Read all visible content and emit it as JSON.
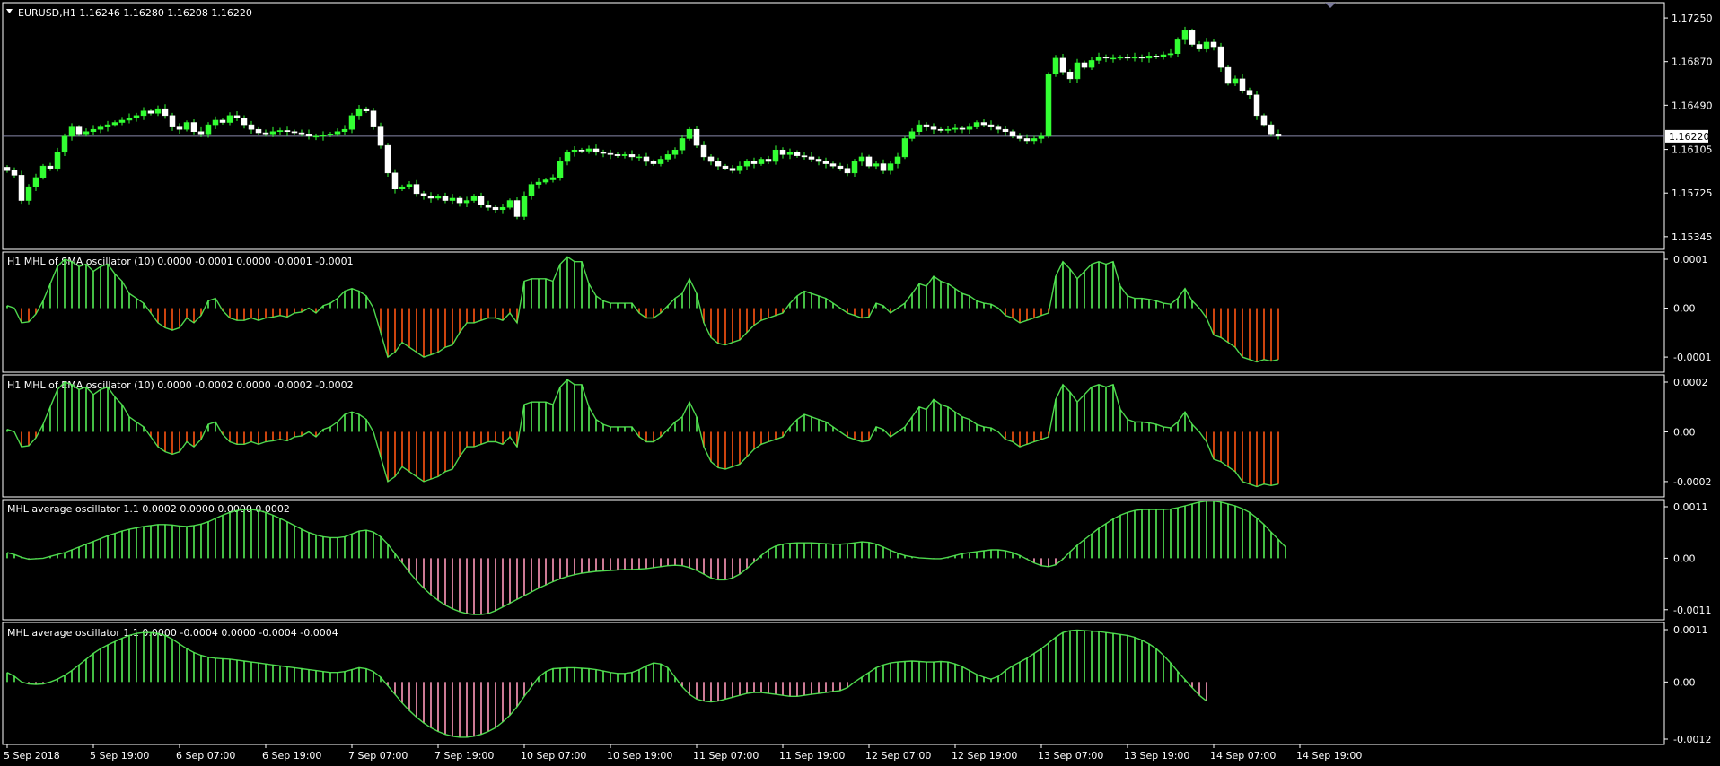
{
  "colors": {
    "background": "#000000",
    "frame": "#ffffff",
    "bull": "#33ff33",
    "bear": "#ffffff",
    "wick": "#33ff33",
    "osc_pos": "#55ee55",
    "osc_neg": "#ff5511",
    "avg_neg": "#ff99bb",
    "price_line": "#8888aa",
    "price_badge_bg": "#ffffff",
    "price_badge_text": "#000000"
  },
  "main": {
    "symbol_label": "EURUSD,H1  1.16246 1.16280 1.16208 1.16220",
    "current_price": "1.16220",
    "y_ticks": [
      "1.17250",
      "1.16870",
      "1.16490",
      "1.16105",
      "1.15725",
      "1.15345"
    ],
    "y_range": [
      1.1525,
      1.1736
    ],
    "current_value": 1.1622
  },
  "panels": [
    {
      "label": "H1 MHL of SMA oscillator (10) 0.0000 -0.0001 0.0000 -0.0001 -0.0001",
      "ticks": [
        "0.0001",
        "0.00",
        "-0.0001"
      ],
      "tick_values": [
        0.0001,
        0,
        -0.0001
      ],
      "neg_color_key": "osc_neg"
    },
    {
      "label": "H1 MHL of EMA oscillator (10) 0.0000 -0.0002 0.0000 -0.0002 -0.0002",
      "ticks": [
        "0.0002",
        "0.00",
        "-0.0002"
      ],
      "tick_values": [
        0.0002,
        0,
        -0.0002
      ],
      "neg_color_key": "osc_neg"
    },
    {
      "label": "MHL average oscillator 1.1 0.0002 0.0000 0.0000 0.0002",
      "ticks": [
        "0.0011",
        "0.00",
        "-0.0011"
      ],
      "tick_values": [
        0.0011,
        0,
        -0.0011
      ],
      "neg_color_key": "avg_neg"
    },
    {
      "label": "MHL average oscillator 1.1 0.0000 -0.0004 0.0000 -0.0004 -0.0004",
      "ticks": [
        "0.0011",
        "0.00",
        "-0.0012"
      ],
      "tick_values": [
        0.0011,
        0,
        -0.0012
      ],
      "neg_color_key": "avg_neg"
    }
  ],
  "x_axis": {
    "labels": [
      "5 Sep 2018",
      "5 Sep 19:00",
      "6 Sep 07:00",
      "6 Sep 19:00",
      "7 Sep 07:00",
      "7 Sep 19:00",
      "10 Sep 07:00",
      "10 Sep 19:00",
      "11 Sep 07:00",
      "11 Sep 19:00",
      "12 Sep 07:00",
      "12 Sep 19:00",
      "13 Sep 07:00",
      "13 Sep 19:00",
      "14 Sep 07:00",
      "14 Sep 19:00"
    ],
    "label_bar_index": [
      0,
      12,
      24,
      36,
      48,
      60,
      72,
      84,
      96,
      108,
      120,
      132,
      144,
      156,
      168,
      180
    ]
  },
  "chart_data": [
    {
      "type": "candlestick",
      "title": "EURUSD,H1",
      "closes": [
        1.1592,
        1.1588,
        1.1566,
        1.1578,
        1.1586,
        1.1596,
        1.1594,
        1.1608,
        1.1622,
        1.163,
        1.1624,
        1.1626,
        1.1628,
        1.163,
        1.1632,
        1.1634,
        1.1636,
        1.1638,
        1.164,
        1.1644,
        1.1642,
        1.1646,
        1.164,
        1.163,
        1.1628,
        1.1634,
        1.1626,
        1.1624,
        1.1632,
        1.1636,
        1.1634,
        1.164,
        1.1638,
        1.1632,
        1.1628,
        1.1625,
        1.1624,
        1.1626,
        1.1627,
        1.1626,
        1.1625,
        1.1624,
        1.1622,
        1.1622,
        1.1623,
        1.1624,
        1.1626,
        1.1628,
        1.164,
        1.1646,
        1.1644,
        1.163,
        1.1614,
        1.159,
        1.1576,
        1.1578,
        1.158,
        1.1572,
        1.157,
        1.1568,
        1.157,
        1.1566,
        1.1568,
        1.1564,
        1.1566,
        1.157,
        1.1562,
        1.156,
        1.1558,
        1.156,
        1.1566,
        1.1552,
        1.157,
        1.158,
        1.1582,
        1.1584,
        1.1586,
        1.16,
        1.1608,
        1.161,
        1.1609,
        1.1611,
        1.1608,
        1.1607,
        1.1606,
        1.1605,
        1.1606,
        1.1604,
        1.1604,
        1.16,
        1.1598,
        1.1602,
        1.1606,
        1.161,
        1.162,
        1.1628,
        1.1614,
        1.1604,
        1.16,
        1.1596,
        1.1594,
        1.1592,
        1.1596,
        1.16,
        1.1598,
        1.1602,
        1.16,
        1.161,
        1.1606,
        1.1608,
        1.1605,
        1.1604,
        1.1602,
        1.16,
        1.1598,
        1.1596,
        1.1594,
        1.159,
        1.16,
        1.1604,
        1.1596,
        1.1598,
        1.1592,
        1.1598,
        1.1604,
        1.162,
        1.1626,
        1.1632,
        1.163,
        1.1628,
        1.1627,
        1.1628,
        1.1629,
        1.1628,
        1.163,
        1.1634,
        1.1632,
        1.163,
        1.1628,
        1.1626,
        1.1622,
        1.162,
        1.1618,
        1.162,
        1.1622,
        1.1676,
        1.169,
        1.1678,
        1.1672,
        1.1686,
        1.1682,
        1.1688,
        1.1691,
        1.169,
        1.169,
        1.1691,
        1.169,
        1.1691,
        1.169,
        1.1692,
        1.1691,
        1.1693,
        1.1694,
        1.1706,
        1.1714,
        1.1702,
        1.1698,
        1.1704,
        1.17,
        1.1682,
        1.1668,
        1.1672,
        1.1662,
        1.1658,
        1.164,
        1.1632,
        1.1624,
        1.1622
      ]
    },
    {
      "type": "histogram",
      "title": "H1 MHL of SMA oscillator (10)",
      "ylim": [
        -0.00012,
        0.0001
      ],
      "values": [
        5e-06,
        0,
        -3e-05,
        -2.8e-05,
        -1.2e-05,
        1.5e-05,
        5e-05,
        8.5e-05,
        0.0001,
        9.5e-05,
        8.5e-05,
        9e-05,
        7.5e-05,
        8.5e-05,
        9e-05,
        7e-05,
        5.5e-05,
        3e-05,
        2e-05,
        1e-05,
        -1e-05,
        -3e-05,
        -4e-05,
        -4.5e-05,
        -4e-05,
        -2e-05,
        -3e-05,
        -1.5e-05,
        1.5e-05,
        2e-05,
        -5e-06,
        -2e-05,
        -2.5e-05,
        -2.5e-05,
        -2e-05,
        -2.5e-05,
        -2e-05,
        -1.8e-05,
        -1.5e-05,
        -1.8e-05,
        -1e-05,
        -8e-06,
        0,
        -1e-05,
        5e-06,
        1e-05,
        2e-05,
        3.5e-05,
        4e-05,
        3.5e-05,
        2.5e-05,
        0,
        -5e-05,
        -0.0001,
        -9e-05,
        -7e-05,
        -8e-05,
        -9e-05,
        -0.0001,
        -9.5e-05,
        -9e-05,
        -8e-05,
        -7.5e-05,
        -5e-05,
        -3e-05,
        -3e-05,
        -2.5e-05,
        -2e-05,
        -2e-05,
        -2.5e-05,
        -1e-05,
        -3e-05,
        5.5e-05,
        6e-05,
        6e-05,
        6e-05,
        5.5e-05,
        9e-05,
        0.000105,
        9.5e-05,
        9.5e-05,
        5e-05,
        2.5e-05,
        1.5e-05,
        1e-05,
        1e-05,
        1e-05,
        1e-05,
        -1e-05,
        -2e-05,
        -2e-05,
        -1e-05,
        5e-06,
        2e-05,
        3e-05,
        6e-05,
        3e-05,
        -3e-05,
        -6e-05,
        -7.2e-05,
        -7.5e-05,
        -7e-05,
        -6.5e-05,
        -5e-05,
        -3.5e-05,
        -2.5e-05,
        -2e-05,
        -1.5e-05,
        -1e-05,
        1e-05,
        2.5e-05,
        3.5e-05,
        3e-05,
        2.5e-05,
        2e-05,
        1e-05,
        0,
        -1e-05,
        -1.5e-05,
        -2e-05,
        -1.8e-05,
        1e-05,
        5e-06,
        -1e-05,
        0,
        1e-05,
        3e-05,
        5e-05,
        4.5e-05,
        6.5e-05,
        5.5e-05,
        5e-05,
        4e-05,
        3e-05,
        2.5e-05,
        1.5e-05,
        1e-05,
        8e-06,
        0,
        -1.5e-05,
        -2e-05,
        -3e-05,
        -2.5e-05,
        -2e-05,
        -1.5e-05,
        -1e-05,
        6.5e-05,
        9.5e-05,
        8e-05,
        6e-05,
        7.5e-05,
        9e-05,
        9.5e-05,
        9e-05,
        9.5e-05,
        4.5e-05,
        2.5e-05,
        2e-05,
        2e-05,
        1.8e-05,
        1.5e-05,
        1e-05,
        8e-06,
        2e-05,
        4e-05,
        1.5e-05,
        0,
        -2e-05,
        -5.5e-05,
        -6e-05,
        -7e-05,
        -8e-05,
        -0.0001,
        -0.000105,
        -0.00011,
        -0.000105,
        -0.000108,
        -0.000105
      ]
    },
    {
      "type": "histogram",
      "title": "H1 MHL of EMA oscillator (10)",
      "ylim": [
        -0.00024,
        0.0002
      ],
      "values": [
        1e-05,
        0,
        -6e-05,
        -5.6e-05,
        -2.4e-05,
        3e-05,
        0.0001,
        0.00017,
        0.0002,
        0.00019,
        0.00017,
        0.00018,
        0.00015,
        0.00017,
        0.00018,
        0.00014,
        0.00011,
        6e-05,
        4e-05,
        2e-05,
        -2e-05,
        -6e-05,
        -8e-05,
        -9e-05,
        -8e-05,
        -4e-05,
        -6e-05,
        -3e-05,
        3e-05,
        4e-05,
        -1e-05,
        -4e-05,
        -5e-05,
        -5e-05,
        -4e-05,
        -5e-05,
        -4e-05,
        -3.6e-05,
        -3e-05,
        -3.6e-05,
        -2e-05,
        -1.6e-05,
        0,
        -2e-05,
        1e-05,
        2e-05,
        4e-05,
        7e-05,
        8e-05,
        7e-05,
        5e-05,
        0,
        -0.0001,
        -0.0002,
        -0.00018,
        -0.00014,
        -0.00016,
        -0.00018,
        -0.0002,
        -0.00019,
        -0.00018,
        -0.00016,
        -0.00015,
        -0.0001,
        -6e-05,
        -6e-05,
        -5e-05,
        -4e-05,
        -4e-05,
        -5e-05,
        -2e-05,
        -6e-05,
        0.00011,
        0.00012,
        0.00012,
        0.00012,
        0.00011,
        0.00018,
        0.00021,
        0.00019,
        0.00019,
        0.0001,
        5e-05,
        3e-05,
        2e-05,
        2e-05,
        2e-05,
        2e-05,
        -2e-05,
        -4e-05,
        -4e-05,
        -2e-05,
        1e-05,
        4e-05,
        6e-05,
        0.00012,
        6e-05,
        -6e-05,
        -0.00012,
        -0.000144,
        -0.00015,
        -0.00014,
        -0.00013,
        -0.0001,
        -7e-05,
        -5e-05,
        -4e-05,
        -3e-05,
        -2e-05,
        2e-05,
        5e-05,
        7e-05,
        6e-05,
        5e-05,
        4e-05,
        2e-05,
        0,
        -2e-05,
        -3e-05,
        -4e-05,
        -3.6e-05,
        2e-05,
        1e-05,
        -2e-05,
        0,
        2e-05,
        6e-05,
        0.0001,
        9e-05,
        0.00013,
        0.00011,
        0.0001,
        8e-05,
        6e-05,
        5e-05,
        3e-05,
        2e-05,
        1.6e-05,
        0,
        -3e-05,
        -4e-05,
        -6e-05,
        -5e-05,
        -4e-05,
        -3e-05,
        -2e-05,
        0.00013,
        0.00019,
        0.00016,
        0.00012,
        0.00015,
        0.00018,
        0.00019,
        0.00018,
        0.00019,
        9e-05,
        5e-05,
        4e-05,
        4e-05,
        3.6e-05,
        3e-05,
        2e-05,
        1.6e-05,
        4e-05,
        8e-05,
        3e-05,
        0,
        -4e-05,
        -0.00011,
        -0.00012,
        -0.00014,
        -0.00016,
        -0.0002,
        -0.00021,
        -0.00022,
        -0.00021,
        -0.000216,
        -0.00021
      ]
    },
    {
      "type": "histogram",
      "title": "MHL average oscillator 1.1",
      "ylim": [
        -0.0012,
        0.0011
      ],
      "values": [
        0.00012,
        8e-05,
        2e-05,
        -2e-05,
        -1e-05,
        0,
        4e-05,
        8e-05,
        0.00012,
        0.00018,
        0.00024,
        0.0003,
        0.00036,
        0.00042,
        0.00048,
        0.00053,
        0.00058,
        0.00062,
        0.00065,
        0.00068,
        0.0007,
        0.00072,
        0.00072,
        0.00071,
        0.00069,
        0.00068,
        0.0007,
        0.00073,
        0.00078,
        0.00085,
        0.00092,
        0.00098,
        0.00102,
        0.00104,
        0.00104,
        0.00102,
        0.00098,
        0.00092,
        0.00085,
        0.00078,
        0.0007,
        0.00062,
        0.00055,
        0.0005,
        0.00046,
        0.00044,
        0.00044,
        0.00046,
        0.00052,
        0.00058,
        0.0006,
        0.00056,
        0.00046,
        0.0003,
        0.0001,
        -0.0001,
        -0.0003,
        -0.00048,
        -0.00064,
        -0.00078,
        -0.0009,
        -0.001,
        -0.00108,
        -0.00114,
        -0.00118,
        -0.0012,
        -0.0012,
        -0.00118,
        -0.00112,
        -0.00104,
        -0.00096,
        -0.00088,
        -0.0008,
        -0.00072,
        -0.00064,
        -0.00057,
        -0.0005,
        -0.00044,
        -0.00039,
        -0.00035,
        -0.00032,
        -0.0003,
        -0.00028,
        -0.00027,
        -0.00026,
        -0.00025,
        -0.00024,
        -0.00024,
        -0.00023,
        -0.00022,
        -0.0002,
        -0.00018,
        -0.00016,
        -0.00015,
        -0.00016,
        -0.0002,
        -0.00026,
        -0.00034,
        -0.00042,
        -0.00046,
        -0.00046,
        -0.00042,
        -0.00034,
        -0.00022,
        -8e-05,
        6e-05,
        0.00018,
        0.00026,
        0.0003,
        0.00032,
        0.00033,
        0.00033,
        0.00033,
        0.00032,
        0.00031,
        0.0003,
        0.0003,
        0.00031,
        0.00033,
        0.00035,
        0.00034,
        0.0003,
        0.00024,
        0.00017,
        0.00011,
        6e-05,
        3e-05,
        1e-05,
        0,
        -1e-05,
        -1e-05,
        2e-05,
        6e-05,
        0.0001,
        0.00012,
        0.00014,
        0.00016,
        0.00018,
        0.00018,
        0.00016,
        0.00012,
        6e-05,
        -2e-05,
        -0.0001,
        -0.00016,
        -0.00018,
        -0.00014,
        -2e-05,
        0.00014,
        0.00028,
        0.0004,
        0.00052,
        0.00064,
        0.00074,
        0.00084,
        0.00092,
        0.00098,
        0.00102,
        0.00104,
        0.00104,
        0.00104,
        0.00104,
        0.00105,
        0.00108,
        0.00112,
        0.00116,
        0.0012,
        0.00122,
        0.00122,
        0.0012,
        0.00116,
        0.00112,
        0.00106,
        0.00098,
        0.00086,
        0.00072,
        0.00056,
        0.0004,
        0.00024
      ]
    },
    {
      "type": "histogram",
      "title": "MHL average oscillator 1.1",
      "ylim": [
        -0.0012,
        0.0011
      ],
      "values": [
        0.0002,
        0.00012,
        0,
        -4e-05,
        -5e-05,
        -4e-05,
        0,
        6e-05,
        0.00014,
        0.00024,
        0.00036,
        0.00048,
        0.0006,
        0.0007,
        0.00078,
        0.00085,
        0.00092,
        0.00098,
        0.00102,
        0.00104,
        0.00104,
        0.00102,
        0.00098,
        0.0009,
        0.0008,
        0.0007,
        0.00062,
        0.00056,
        0.00052,
        0.0005,
        0.00049,
        0.00048,
        0.00046,
        0.00044,
        0.00042,
        0.0004,
        0.00038,
        0.00036,
        0.00034,
        0.00032,
        0.0003,
        0.00028,
        0.00026,
        0.00024,
        0.00022,
        0.0002,
        0.0002,
        0.00022,
        0.00026,
        0.0003,
        0.00028,
        0.00022,
        0.0001,
        -8e-05,
        -0.00026,
        -0.00044,
        -0.0006,
        -0.00074,
        -0.00086,
        -0.00096,
        -0.00104,
        -0.0011,
        -0.00114,
        -0.00116,
        -0.00116,
        -0.00114,
        -0.0011,
        -0.00104,
        -0.00096,
        -0.00084,
        -0.0007,
        -0.00052,
        -0.0003,
        -0.0001,
        0.0001,
        0.00022,
        0.00028,
        0.00029,
        0.0003,
        0.0003,
        0.00029,
        0.00028,
        0.00026,
        0.00023,
        0.0002,
        0.00018,
        0.00018,
        0.0002,
        0.00026,
        0.00034,
        0.0004,
        0.00038,
        0.0003,
        0.0001,
        -0.0001,
        -0.00026,
        -0.00036,
        -0.0004,
        -0.00042,
        -0.0004,
        -0.00036,
        -0.00032,
        -0.00028,
        -0.00024,
        -0.00022,
        -0.00022,
        -0.00024,
        -0.00026,
        -0.00028,
        -0.0003,
        -0.0003,
        -0.00028,
        -0.00026,
        -0.00024,
        -0.00022,
        -0.0002,
        -0.00018,
        -0.00012,
        0,
        0.0001,
        0.0002,
        0.0003,
        0.00036,
        0.0004,
        0.00042,
        0.00043,
        0.00044,
        0.00043,
        0.00042,
        0.00042,
        0.00043,
        0.00042,
        0.00038,
        0.00032,
        0.00024,
        0.00016,
        0.0001,
        6e-05,
        0.00012,
        0.00024,
        0.00034,
        0.00042,
        0.0005,
        0.0006,
        0.0007,
        0.00082,
        0.00094,
        0.00104,
        0.00108,
        0.00109,
        0.00108,
        0.00107,
        0.00106,
        0.00104,
        0.00102,
        0.001,
        0.00098,
        0.00094,
        0.00088,
        0.0008,
        0.0007,
        0.00056,
        0.0004,
        0.00022,
        5e-05,
        -0.00012,
        -0.00028,
        -0.0004
      ]
    }
  ]
}
